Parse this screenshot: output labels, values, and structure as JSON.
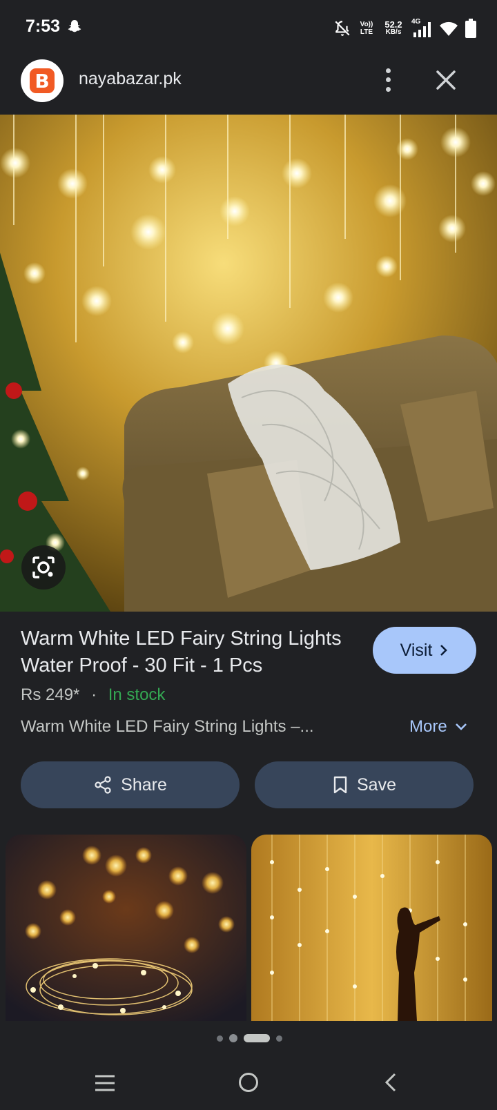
{
  "status_bar": {
    "time": "7:53",
    "network_type": "Vo)) LTE",
    "speed_value": "52.2",
    "speed_unit": "KB/s",
    "signal_label": "4G",
    "icons": [
      "snapchat-icon",
      "mute-icon",
      "signal-icon",
      "wifi-icon",
      "battery-icon"
    ]
  },
  "browser": {
    "site_icon_letter": "B",
    "site_name": "nayabazar.pk",
    "menu_icon": "more-vert-icon",
    "close_icon": "close-icon"
  },
  "product": {
    "title": "Warm White LED Fairy String Lights Water Proof - 30 Fit - 1 Pcs",
    "visit_label": "Visit",
    "price": "Rs 249*",
    "separator": "·",
    "stock": "In stock",
    "description": "Warm White LED Fairy String Lights –...",
    "more_label": "More",
    "share_label": "Share",
    "save_label": "Save"
  },
  "colors": {
    "background": "#202124",
    "accent": "#a8c7fa",
    "button": "#37455a",
    "stock": "#34a853",
    "site_brand": "#f15a24"
  },
  "pager": {
    "count": 4,
    "active_index": 2
  },
  "nav": [
    "recents-icon",
    "home-icon",
    "back-icon"
  ]
}
